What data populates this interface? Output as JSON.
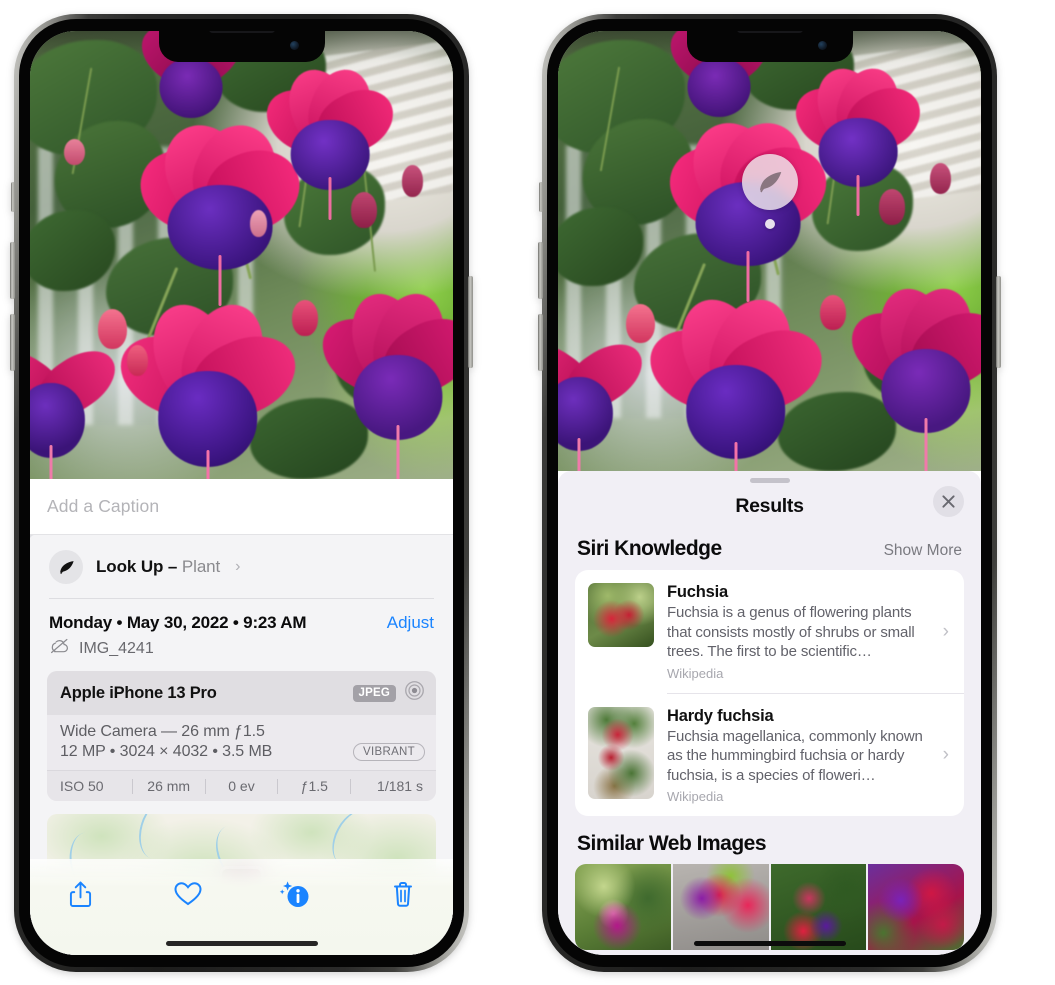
{
  "left_phone": {
    "photo": {
      "alt": "fuchsia-flowers-photo"
    },
    "caption_placeholder": "Add a Caption",
    "lookup": {
      "icon": "leaf-icon",
      "sparkle_icon": "sparkle-icon",
      "label": "Look Up – ",
      "subject": "Plant",
      "chevron": "›"
    },
    "date": "Monday • May 30, 2022 • 9:23 AM",
    "adjust_label": "Adjust",
    "cloud_icon": "cloud-slash-icon",
    "file_name": "IMG_4241",
    "exif": {
      "device": "Apple iPhone 13 Pro",
      "format_badge": "JPEG",
      "aperture_icon": "aperture-icon",
      "lens_line": "Wide Camera — 26 mm ƒ1.5",
      "specs_line": "12 MP • 3024 × 4032 • 3.5 MB",
      "style_badge": "VIBRANT",
      "stats": [
        "ISO 50",
        "26 mm",
        "0 ev",
        "ƒ1.5",
        "1/181 s"
      ]
    },
    "map": {
      "pin": "photo-pin"
    },
    "toolbar": [
      {
        "name": "share-icon",
        "label": "Share"
      },
      {
        "name": "favorite-heart-icon",
        "label": "Favorite"
      },
      {
        "name": "info-sparkle-icon",
        "label": "Info"
      },
      {
        "name": "trash-icon",
        "label": "Delete"
      }
    ]
  },
  "right_phone": {
    "photo": {
      "alt": "fuchsia-flowers-photo"
    },
    "lookup_badge": {
      "icon": "leaf-icon",
      "name": "visual-look-up-badge"
    },
    "panel": {
      "grabber": "drag-handle",
      "title": "Results",
      "close_icon": "close-icon",
      "siri_section": {
        "title": "Siri Knowledge",
        "show_more": "Show More",
        "items": [
          {
            "title": "Fuchsia",
            "desc": "Fuchsia is a genus of flowering plants that consists mostly of shrubs or small trees. The first to be scientific…",
            "source": "Wikipedia",
            "chevron": "›"
          },
          {
            "title": "Hardy fuchsia",
            "desc": "Fuchsia magellanica, commonly known as the hummingbird fuchsia or hardy fuchsia, is a species of floweri…",
            "source": "Wikipedia",
            "chevron": "›"
          }
        ]
      },
      "similar_section": {
        "title": "Similar Web Images",
        "images": [
          {
            "name": "similar-image-1"
          },
          {
            "name": "similar-image-2"
          },
          {
            "name": "similar-image-3"
          },
          {
            "name": "similar-image-4"
          }
        ]
      }
    }
  },
  "colors": {
    "accent_blue": "#1a84ff",
    "panel_bg": "#f1eff5",
    "card_bg": "#ffffff",
    "sheet_bg": "#f4f4f6"
  }
}
